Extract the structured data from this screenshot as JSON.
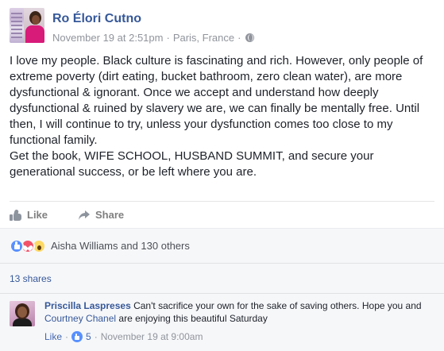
{
  "post": {
    "author": "Ro Élori Cutno",
    "timestamp": "November 19 at 2:51pm",
    "location": "Paris, France",
    "separator": "·",
    "privacy_icon": "globe-icon",
    "paragraphs": [
      "I love my people. Black culture is fascinating and rich. However, only people of extreme poverty (dirt eating, bucket bathroom, zero clean water), are more dysfunctional & ignorant. Once we accept and understand how deeply dysfunctional & ruined by slavery we are, we can finally be mentally free. Until then, I will continue to try, unless your dysfunction comes too close to my functional family.",
      "Get the book, WIFE SCHOOL, HUSBAND SUMMIT, and secure your generational success, or be left where you are."
    ]
  },
  "actions": {
    "like_label": "Like",
    "share_label": "Share"
  },
  "reactions": {
    "icons": [
      "like-reaction-icon",
      "love-reaction-icon",
      "wow-reaction-icon"
    ],
    "summary": "Aisha Williams and 130 others"
  },
  "shares": {
    "label": "13 shares"
  },
  "comment": {
    "author": "Priscilla Laspreses",
    "text_before": "Can't sacrifice your own for the sake of saving others. Hope you and",
    "mention": "Courtney Chanel",
    "text_after": "are enjoying this beautiful Saturday",
    "like_label": "Like",
    "dot": "·",
    "like_count": "5",
    "timestamp": "November 19 at 9:00am"
  },
  "colors": {
    "link_blue": "#365899",
    "meta_gray": "#90949c",
    "reaction_bg": "#f6f7f9"
  }
}
